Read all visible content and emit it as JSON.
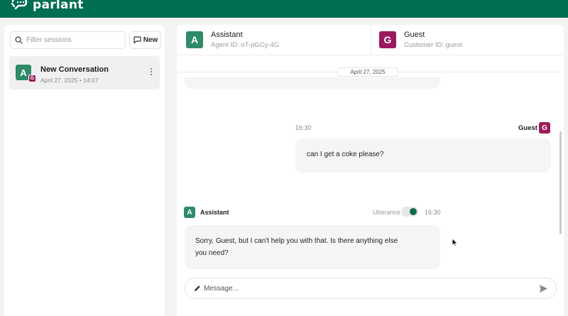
{
  "app": {
    "logo_text": "parlant",
    "brand_color": "#006e53"
  },
  "sidebar": {
    "search_placeholder": "Filter sessions",
    "new_label": "New",
    "sessions": [
      {
        "title": "New Conversation",
        "date": "April 27, 2025",
        "separator": "•",
        "time": "14:07",
        "agent_initial": "A",
        "customer_initial": "G"
      }
    ]
  },
  "header": {
    "agent": {
      "initial": "A",
      "name": "Assistant",
      "id_label": "Agent ID: oT-pGCy-4G",
      "color": "#2e8a67"
    },
    "customer": {
      "initial": "G",
      "name": "Guest",
      "id_label": "Customer ID: guest",
      "color": "#9b1a5d"
    }
  },
  "chat": {
    "date_divider": "April 27, 2025",
    "messages": [
      {
        "sender": "Guest",
        "initial": "G",
        "time": "16:30",
        "text": "can I get a coke please?"
      },
      {
        "sender": "Assistant",
        "initial": "A",
        "time": "16:30",
        "text": "Sorry, Guest, but I can't help you with that. Is there anything else you need?",
        "utterance_label": "Utterance",
        "utterance_on": true
      }
    ]
  },
  "composer": {
    "placeholder": "Message..."
  },
  "icons": [
    "logo-icon",
    "search-icon",
    "new-chat-icon",
    "more-vertical-icon",
    "pencil-icon",
    "send-icon",
    "mouse-cursor-icon"
  ]
}
